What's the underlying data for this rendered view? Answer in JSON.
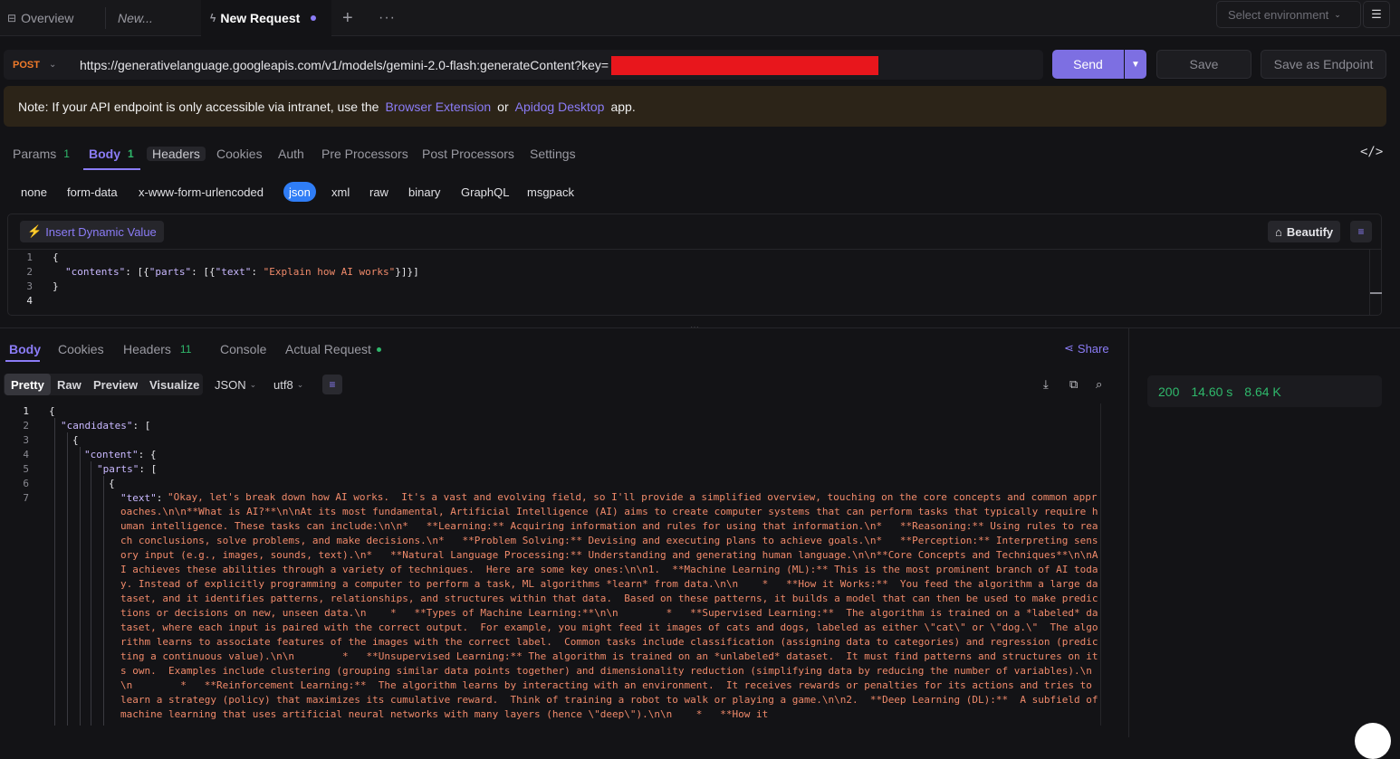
{
  "tabs": {
    "overview": "Overview",
    "new_tab": "New...",
    "active": "New Request"
  },
  "environment": {
    "placeholder": "Select environment"
  },
  "request": {
    "method": "POST",
    "url": "https://generativelanguage.googleapis.com/v1/models/gemini-2.0-flash:generateContent?key=",
    "send_label": "Send",
    "save_label": "Save",
    "save_endpoint_label": "Save as Endpoint"
  },
  "note": {
    "prefix": "Note: If your API endpoint is only accessible via intranet, use the",
    "link1": "Browser Extension",
    "middle": "or",
    "link2": "Apidog Desktop",
    "suffix": "app."
  },
  "request_tabs": [
    {
      "label": "Params",
      "count": "1"
    },
    {
      "label": "Body",
      "count": "1"
    },
    {
      "label": "Headers"
    },
    {
      "label": "Cookies"
    },
    {
      "label": "Auth"
    },
    {
      "label": "Pre Processors"
    },
    {
      "label": "Post Processors"
    },
    {
      "label": "Settings"
    }
  ],
  "body_types": [
    "none",
    "form-data",
    "x-www-form-urlencoded",
    "json",
    "xml",
    "raw",
    "binary",
    "GraphQL",
    "msgpack"
  ],
  "editor": {
    "insert_dynamic": "Insert Dynamic Value",
    "beautify": "Beautify",
    "line_numbers": [
      "1",
      "2",
      "3",
      "4"
    ],
    "lines": {
      "l1": "{",
      "l2_key": "\"contents\"",
      "l2_mid": ": [{",
      "l2_key2": "\"parts\"",
      "l2_mid2": ": [{",
      "l2_key3": "\"text\"",
      "l2_mid3": ": ",
      "l2_val": "\"Explain how AI works\"",
      "l2_end": "}]}]",
      "l3": "}"
    }
  },
  "response_tabs": [
    {
      "label": "Body"
    },
    {
      "label": "Cookies"
    },
    {
      "label": "Headers",
      "count": "11"
    },
    {
      "label": "Console"
    },
    {
      "label": "Actual Request"
    }
  ],
  "share_label": "Share",
  "view_options": [
    "Pretty",
    "Raw",
    "Preview",
    "Visualize"
  ],
  "format": "JSON",
  "encoding": "utf8",
  "response": {
    "line_numbers": [
      "1",
      "2",
      "3",
      "4",
      "5",
      "6",
      "7"
    ],
    "l1": "{",
    "l2_key": "\"candidates\"",
    "l2_end": ": [",
    "l3": "{",
    "l4_key": "\"content\"",
    "l4_end": ": {",
    "l5_key": "\"parts\"",
    "l5_end": ": [",
    "l6": "{",
    "l7_key": "\"text\"",
    "l7_mid": ": ",
    "l7_val": "\"Okay, let's break down how AI works.  It's a vast and evolving field, so I'll provide a simplified overview, touching on the core concepts and common approaches.\\n\\n**What is AI?**\\n\\nAt its most fundamental, Artificial Intelligence (AI) aims to create computer systems that can perform tasks that typically require human intelligence. These tasks can include:\\n\\n*   **Learning:** Acquiring information and rules for using that information.\\n*   **Reasoning:** Using rules to reach conclusions, solve problems, and make decisions.\\n*   **Problem Solving:** Devising and executing plans to achieve goals.\\n*   **Perception:** Interpreting sensory input (e.g., images, sounds, text).\\n*   **Natural Language Processing:** Understanding and generating human language.\\n\\n**Core Concepts and Techniques**\\n\\nAI achieves these abilities through a variety of techniques.  Here are some key ones:\\n\\n1.  **Machine Learning (ML):** This is the most prominent branch of AI today. Instead of explicitly programming a computer to perform a task, ML algorithms *learn* from data.\\n\\n    *   **How it Works:**  You feed the algorithm a large dataset, and it identifies patterns, relationships, and structures within that data.  Based on these patterns, it builds a model that can then be used to make predictions or decisions on new, unseen data.\\n    *   **Types of Machine Learning:**\\n\\n        *   **Supervised Learning:**  The algorithm is trained on a *labeled* dataset, where each input is paired with the correct output.  For example, you might feed it images of cats and dogs, labeled as either \\\"cat\\\" or \\\"dog.\\\"  The algorithm learns to associate features of the images with the correct label.  Common tasks include classification (assigning data to categories) and regression (predicting a continuous value).\\n\\n        *   **Unsupervised Learning:** The algorithm is trained on an *unlabeled* dataset.  It must find patterns and structures on its own.  Examples include clustering (grouping similar data points together) and dimensionality reduction (simplifying data by reducing the number of variables).\\n\\n        *   **Reinforcement Learning:**  The algorithm learns by interacting with an environment.  It receives rewards or penalties for its actions and tries to learn a strategy (policy) that maximizes its cumulative reward.  Think of training a robot to walk or playing a game.\\n\\n2.  **Deep Learning (DL):**  A subfield of machine learning that uses artificial neural networks with many layers (hence \\\"deep\\\").\\n\\n    *   **How it"
  },
  "status": {
    "code": "200",
    "time": "14.60 s",
    "size": "8.64 K"
  },
  "colors": {
    "accent": "#8b7cf6",
    "method": "#f07a2a",
    "success": "#2fb86b",
    "json_active": "#2f7df6"
  }
}
